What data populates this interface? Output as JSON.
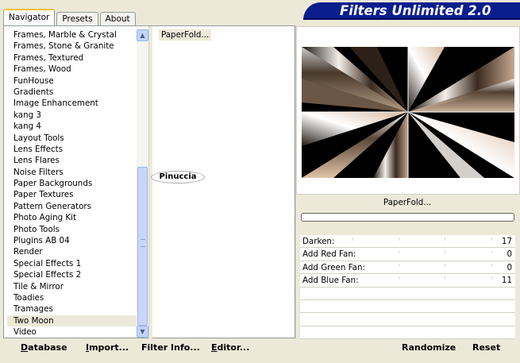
{
  "tabs": [
    {
      "label": "Navigator",
      "active": true
    },
    {
      "label": "Presets",
      "active": false
    },
    {
      "label": "About",
      "active": false
    }
  ],
  "banner": {
    "title": "Filters Unlimited 2.0"
  },
  "filter_list": {
    "items": [
      "Frames, Marble & Crystal",
      "Frames, Stone & Granite",
      "Frames, Textured",
      "Frames, Wood",
      "FunHouse",
      "Gradients",
      "Image Enhancement",
      "kang 3",
      "kang 4",
      "Layout Tools",
      "Lens Effects",
      "Lens Flares",
      "Noise Filters",
      "Paper Backgrounds",
      "Paper Textures",
      "Pattern Generators",
      "Photo Aging Kit",
      "Photo Tools",
      "Plugins AB 04",
      "Render",
      "Special Effects 1",
      "Special Effects 2",
      "Tile & Mirror",
      "Toadies",
      "Tramages",
      "Two Moon",
      "Video"
    ],
    "selected": "Two Moon"
  },
  "plugin_list": {
    "items": [
      "PaperFold..."
    ]
  },
  "watermark": {
    "text": "Pinuccia"
  },
  "preview": {
    "filter_name": "PaperFold...",
    "progress": 0
  },
  "controls": [
    {
      "label": "Darken:",
      "value": "17"
    },
    {
      "label": "Add Red Fan:",
      "value": "0"
    },
    {
      "label": "Add Green Fan:",
      "value": "0"
    },
    {
      "label": "Add Blue Fan:",
      "value": "11"
    }
  ],
  "buttons": {
    "database": {
      "underline": "D",
      "rest": "atabase"
    },
    "import": {
      "underline": "I",
      "rest": "mport..."
    },
    "filter_info": {
      "label": "Filter Info..."
    },
    "editor": {
      "underline": "E",
      "rest": "ditor..."
    },
    "randomize": {
      "label": "Randomize"
    },
    "reset": {
      "label": "Reset"
    }
  }
}
